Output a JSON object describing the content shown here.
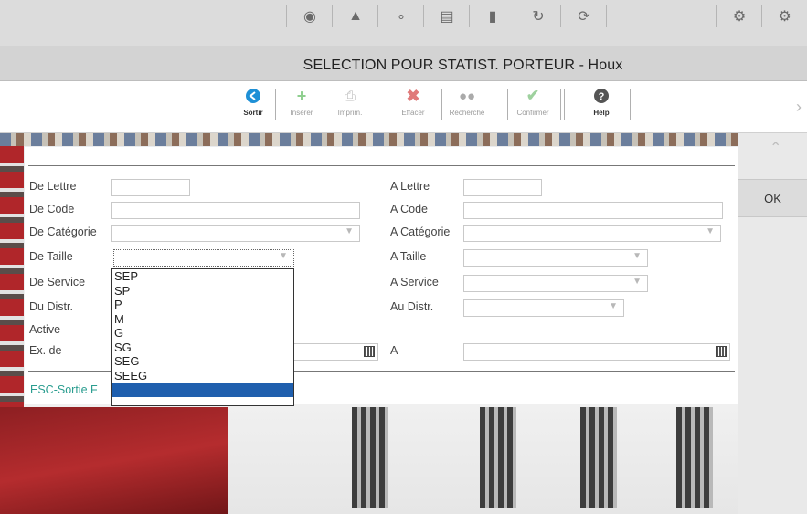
{
  "title": "SELECTION POUR STATIST. PORTEUR - Houx",
  "top_icons": [
    "eye-icon",
    "flask-icon",
    "molecule-icon",
    "grid-icon",
    "document-icon",
    "refresh-icon",
    "cycle-icon",
    "settings-icon",
    "gear-icon"
  ],
  "toolbar": {
    "sortir": "Sortir",
    "inserer": "Insérer",
    "imprim": "Imprim.",
    "effacer": "Effacer",
    "recherche": "Recherche",
    "confirmer": "Confirmer",
    "help": "Help"
  },
  "ok_label": "OK",
  "form": {
    "de_lettre": "De Lettre",
    "a_lettre": "A Lettre",
    "de_code": "De Code",
    "a_code": "A Code",
    "de_categorie": "De Catégorie",
    "a_categorie": "A Catégorie",
    "de_taille": "De Taille",
    "a_taille": "A Taille",
    "de_service": "De Service",
    "a_service": "A Service",
    "du_distr": "Du Distr.",
    "au_distr": "Au Distr.",
    "active": "Active",
    "ex_de": "Ex. de",
    "a": "A",
    "footer": "ESC-Sortie F"
  },
  "taille_options": [
    "SEP",
    "SP",
    "P",
    "M",
    "G",
    "SG",
    "SEG",
    "SEEG",
    ""
  ],
  "taille_highlighted_index": 8,
  "colors": {
    "accent": "#1f5fae",
    "footer_link": "#2a9d8f",
    "delete": "#d9534f",
    "insert": "#5cb85c"
  }
}
